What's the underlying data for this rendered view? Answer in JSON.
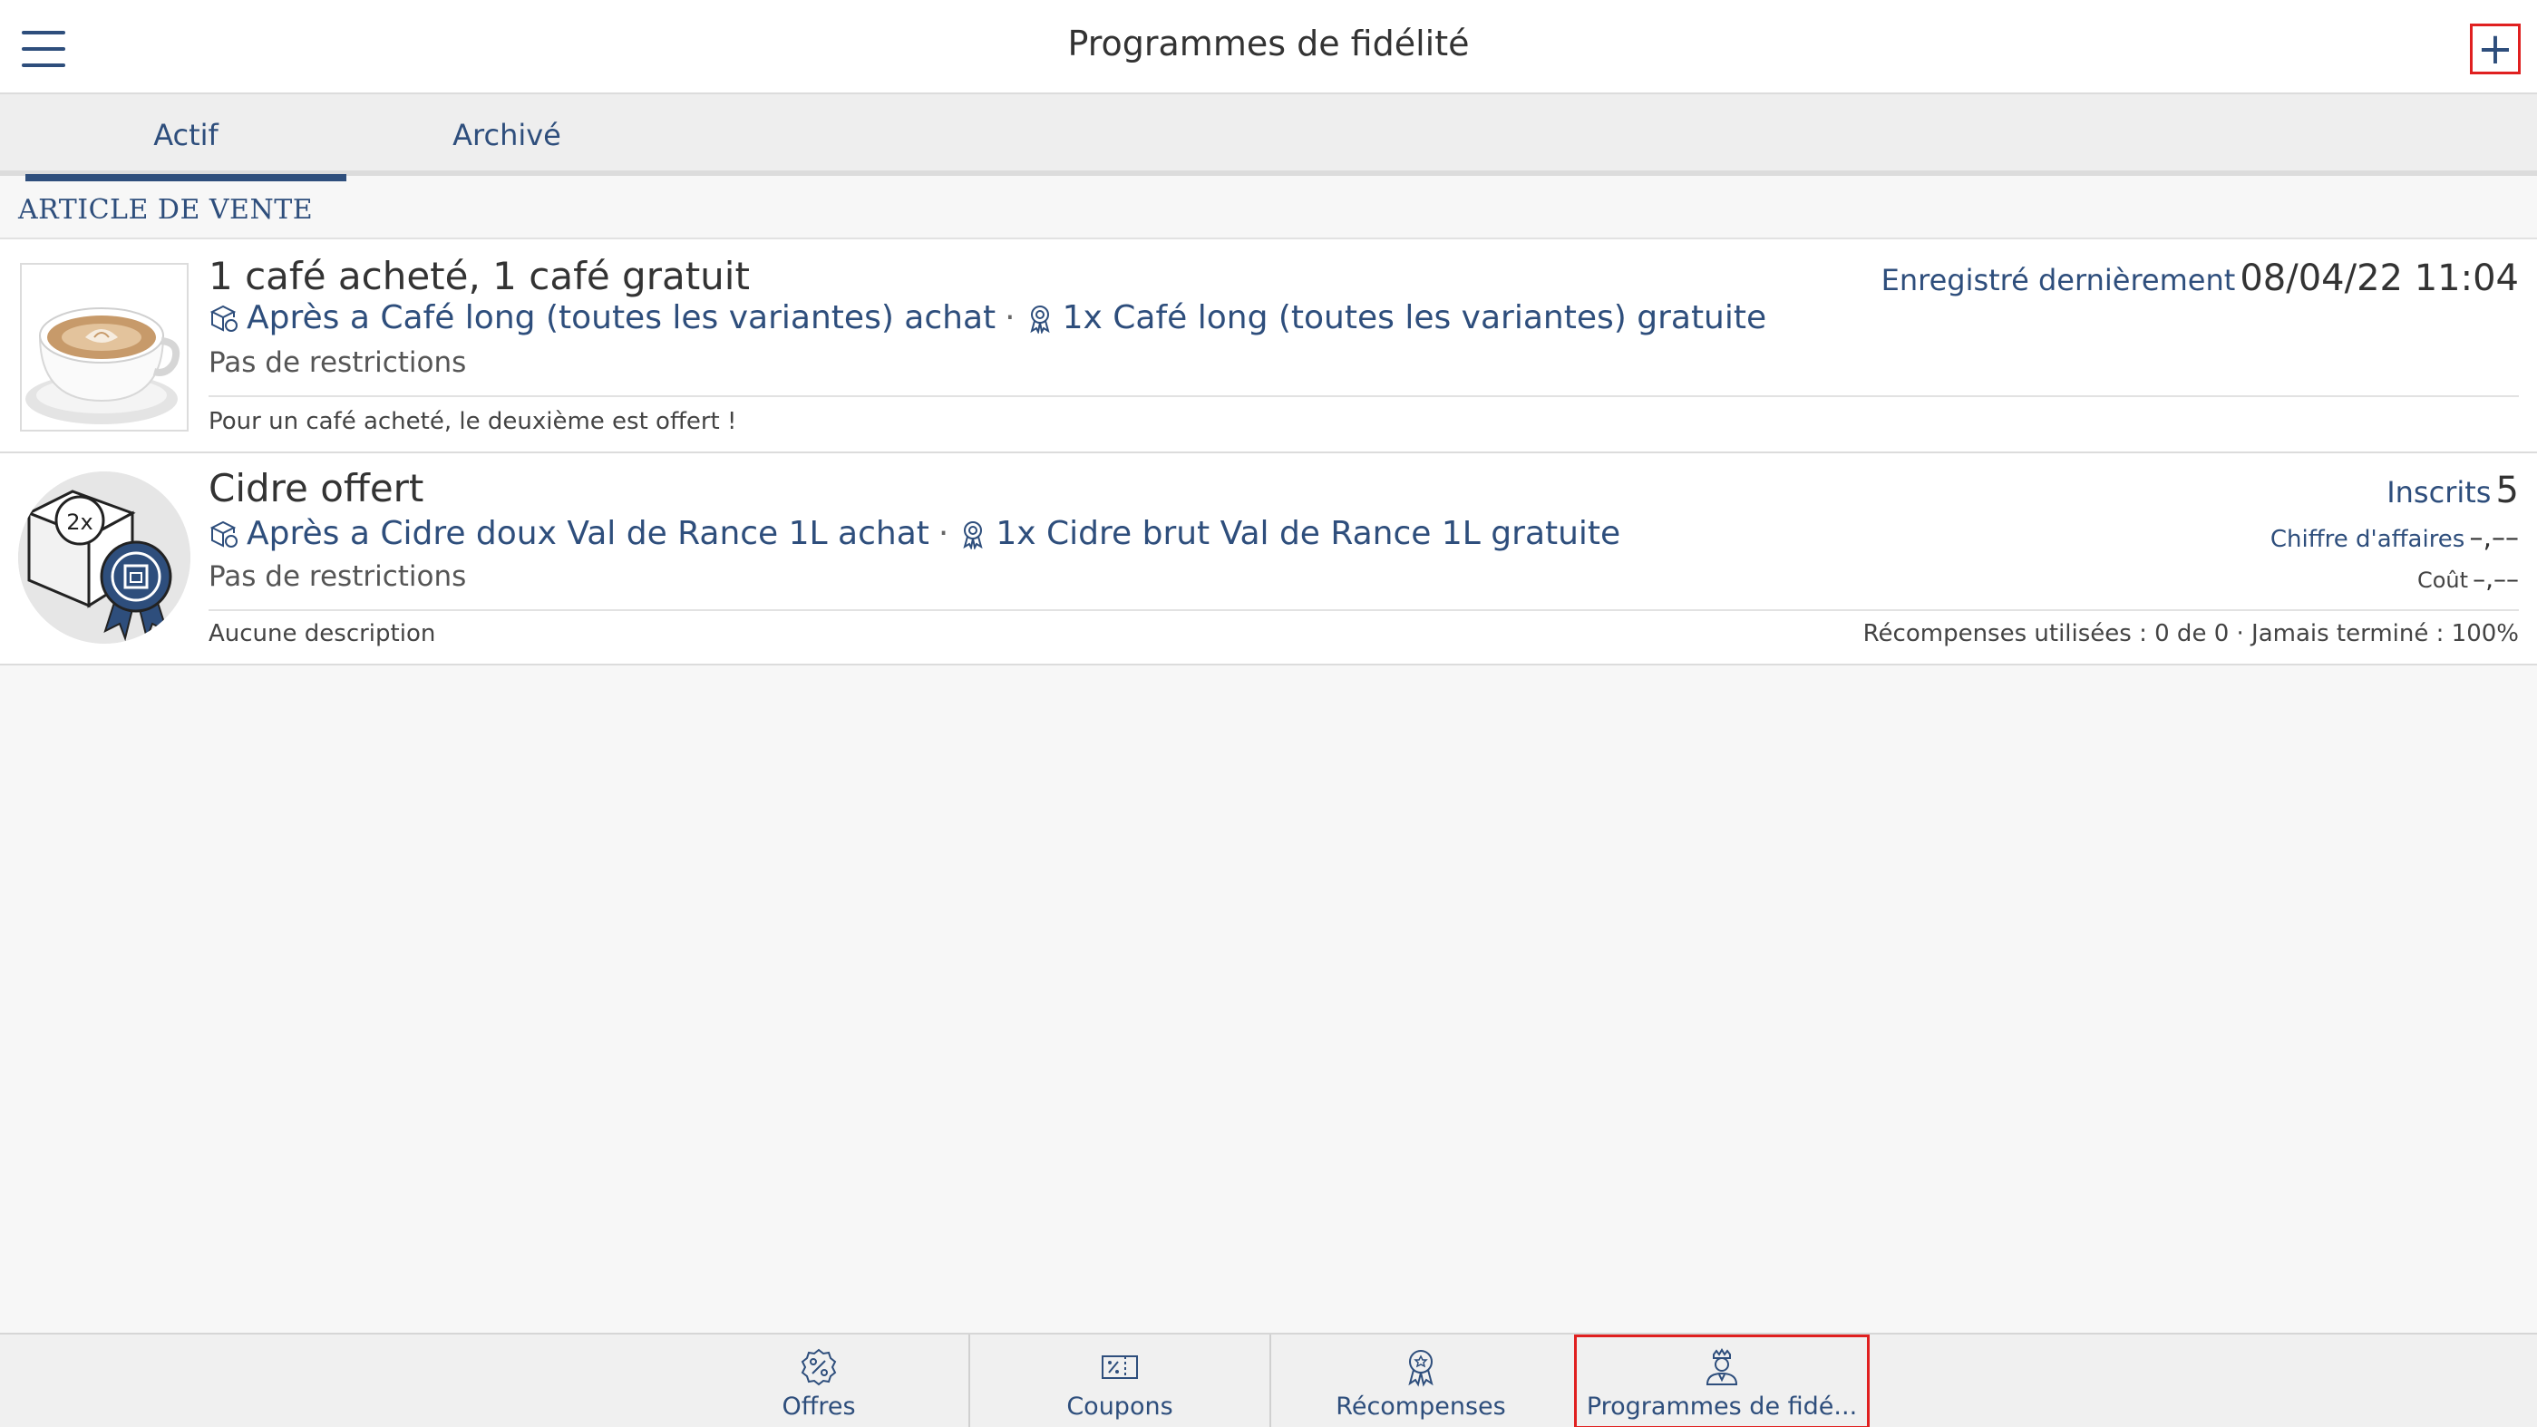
{
  "header": {
    "title": "Programmes de fidélité",
    "add_label": "+"
  },
  "tabs": [
    {
      "label": "Actif",
      "active": true
    },
    {
      "label": "Archivé",
      "active": false
    }
  ],
  "section": {
    "title": "ARTICLE DE VENTE"
  },
  "programs": [
    {
      "title": "1 café acheté, 1 café gratuit",
      "condition": "Après a Café long (toutes les variantes) achat",
      "separator": "·",
      "reward": "1x Café long (toutes les variantes) gratuite",
      "restrictions": "Pas de restrictions",
      "description": "Pour un café acheté, le deuxième est offert !",
      "saved_label": "Enregistré dernièrement",
      "saved_value": "08/04/22 11:04"
    },
    {
      "title": "Cidre offert",
      "condition": "Après a Cidre doux Val de Rance 1L achat",
      "separator": "·",
      "reward": "1x Cidre brut Val de Rance 1L gratuite",
      "restrictions": "Pas de restrictions",
      "description": "Aucune description",
      "badge_text": "2x",
      "enrolled_label": "Inscrits",
      "enrolled_value": "5",
      "revenue_label": "Chiffre d'affaires",
      "revenue_value": "–,––",
      "cost_label": "Coût",
      "cost_value": "–,––",
      "usage_text": "Récompenses utilisées : 0 de 0 · Jamais terminé :  100%"
    }
  ],
  "bottom_nav": [
    {
      "label": "Offres",
      "icon": "percent-badge-icon"
    },
    {
      "label": "Coupons",
      "icon": "coupon-icon"
    },
    {
      "label": "Récompenses",
      "icon": "award-ribbon-icon"
    },
    {
      "label": "Programmes de fidé...",
      "icon": "loyalty-person-icon",
      "selected": true
    }
  ],
  "colors": {
    "accent": "#2e4e7c",
    "highlight": "#e02020",
    "background": "#f7f7f7"
  }
}
